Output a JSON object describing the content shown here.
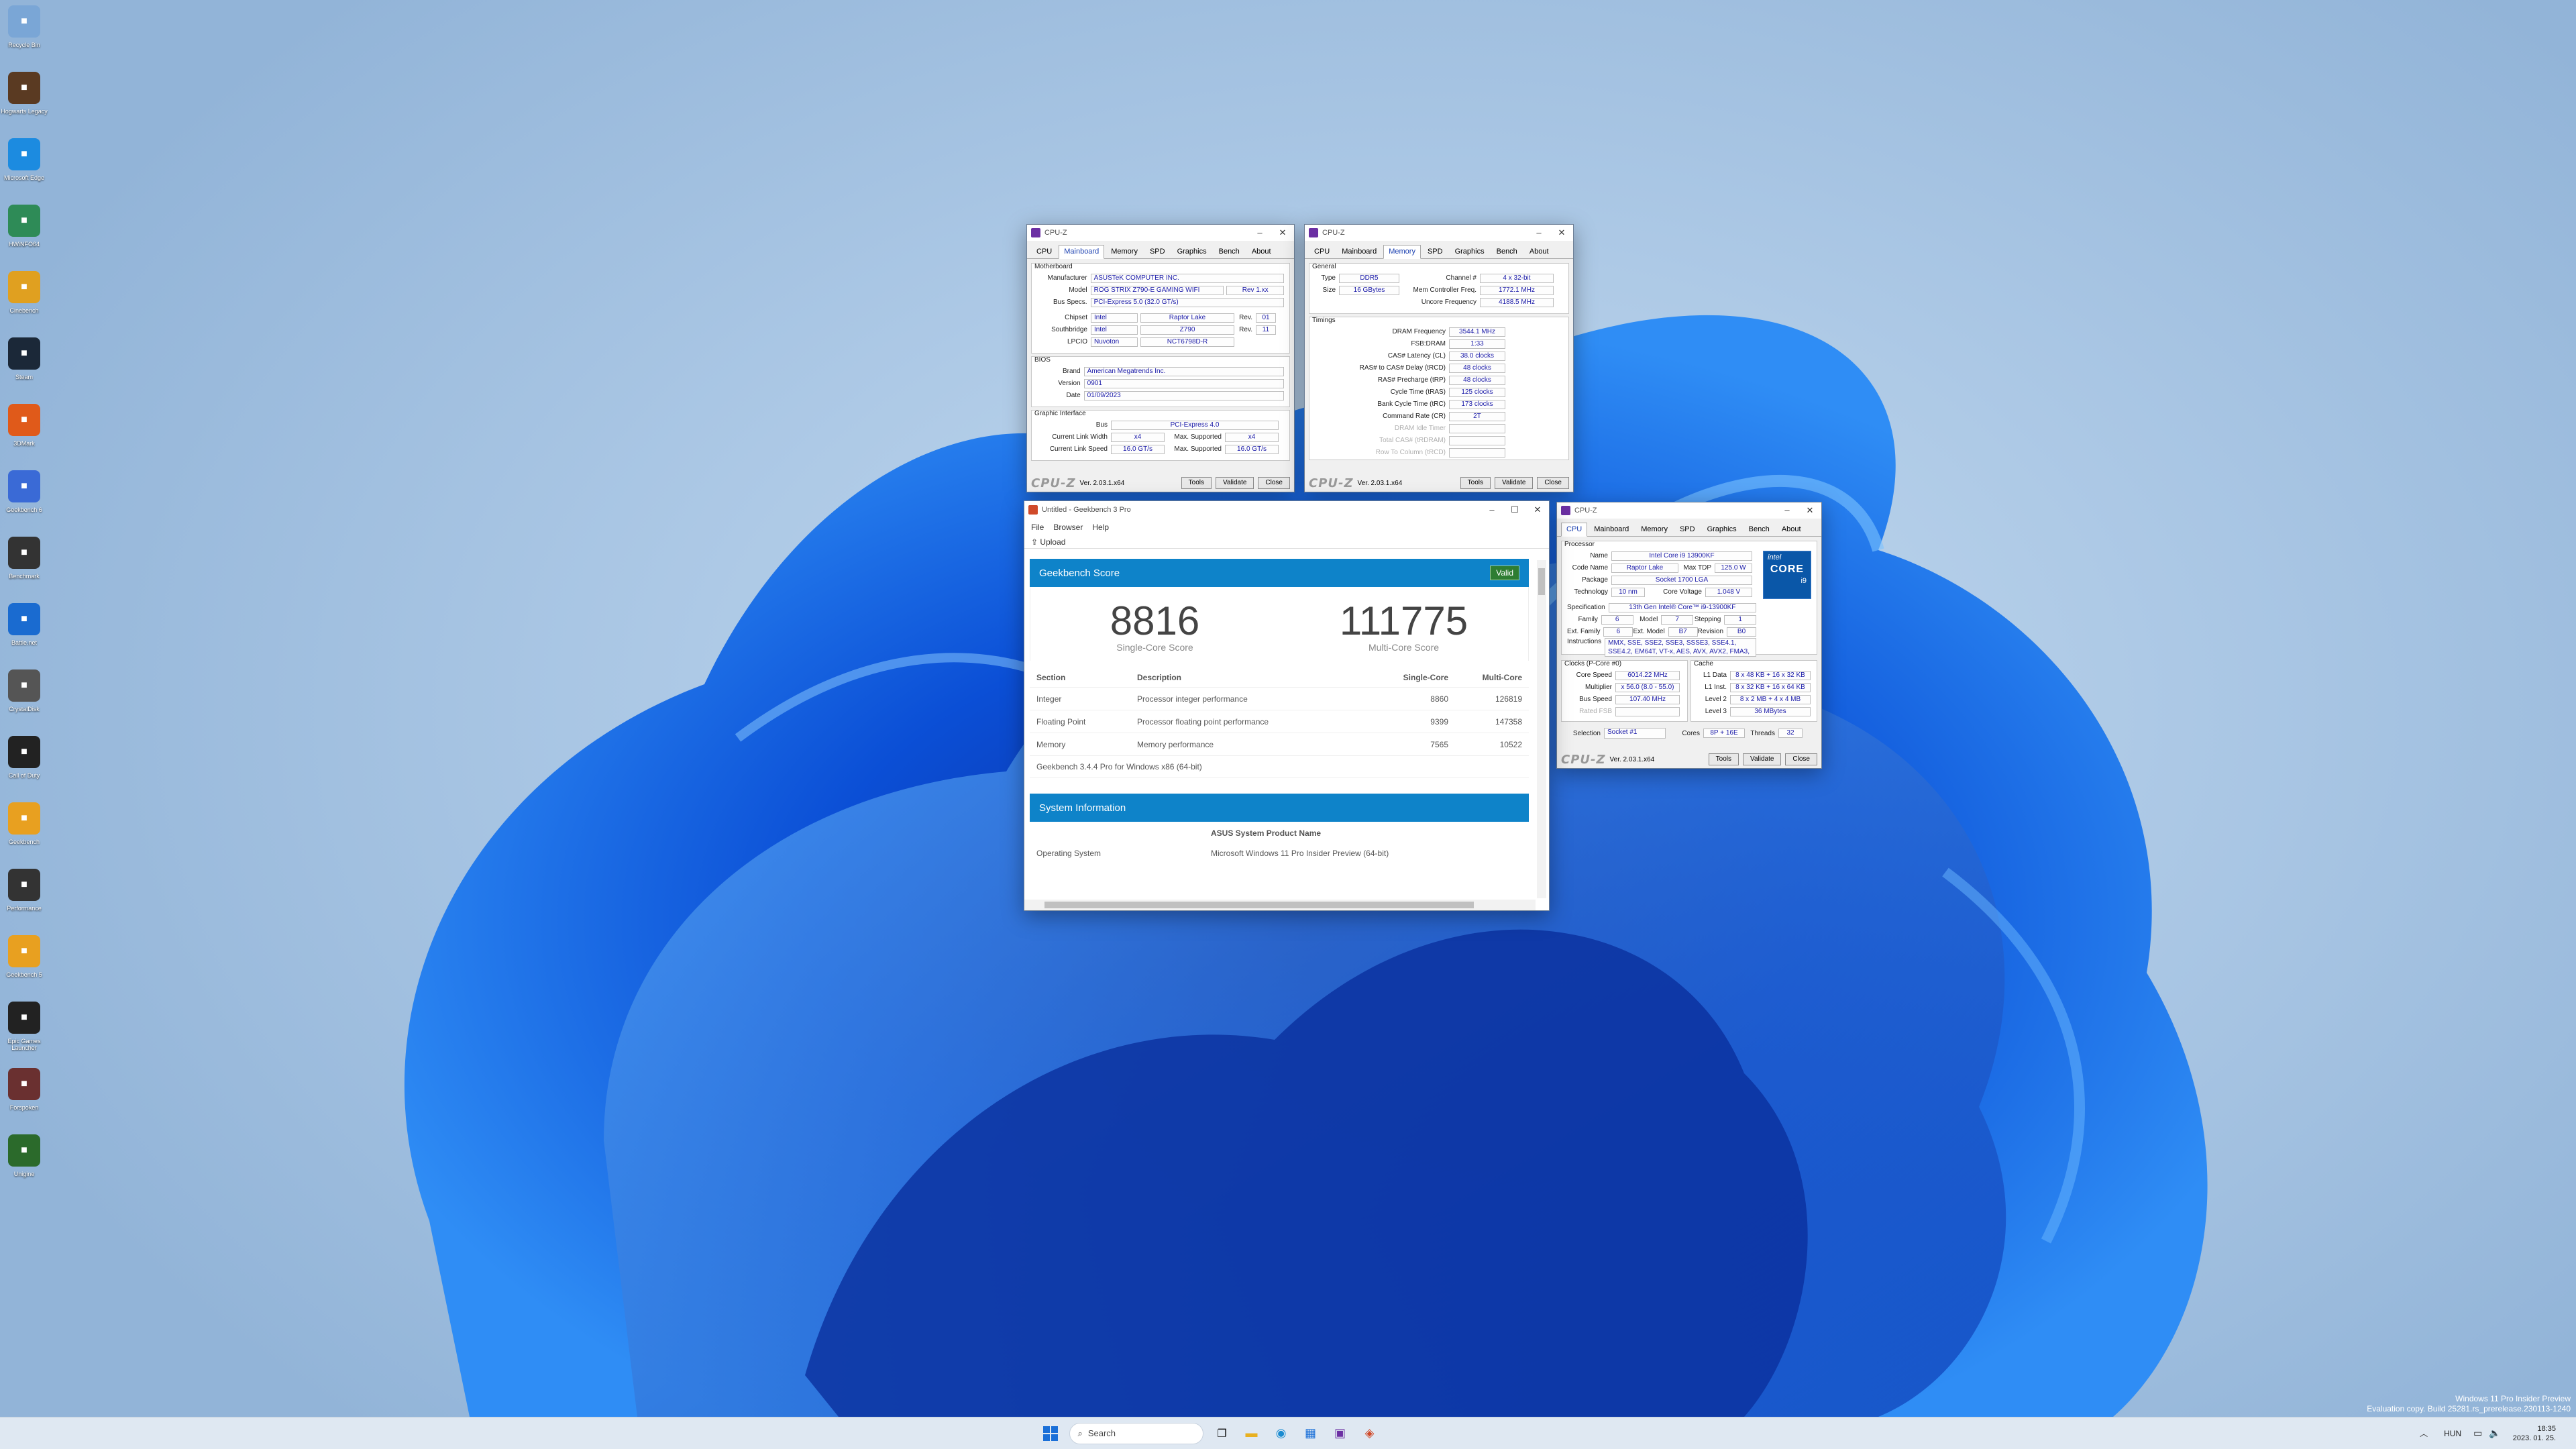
{
  "desktop_icons": [
    {
      "label": "Recycle Bin",
      "color": "#7aa6d6"
    },
    {
      "label": "Hogwarts Legacy",
      "color": "#5a3a22"
    },
    {
      "label": "Microsoft Edge",
      "color": "#1c8be0"
    },
    {
      "label": "HWiNFO64",
      "color": "#2e8b57"
    },
    {
      "label": "Cinebench",
      "color": "#e0a020"
    },
    {
      "label": "Steam",
      "color": "#1b2838"
    },
    {
      "label": "3DMark",
      "color": "#e05a1a"
    },
    {
      "label": "Geekbench 6",
      "color": "#3a6ad6"
    },
    {
      "label": "Benchmark",
      "color": "#333"
    },
    {
      "label": "Battle.net",
      "color": "#1a6bd0"
    },
    {
      "label": "CrystalDisk",
      "color": "#555"
    },
    {
      "label": "Call of Duty",
      "color": "#222"
    },
    {
      "label": "Geekbench",
      "color": "#e8a020"
    },
    {
      "label": "Performance",
      "color": "#333"
    },
    {
      "label": "Geekbench 5",
      "color": "#e8a020"
    },
    {
      "label": "Epic Games Launcher",
      "color": "#222"
    },
    {
      "label": "Forspoken",
      "color": "#6a3030"
    },
    {
      "label": "Unigine",
      "color": "#2b6a2b"
    }
  ],
  "cpuz_mb": {
    "title": "CPU-Z",
    "tabs": [
      "CPU",
      "Mainboard",
      "Memory",
      "SPD",
      "Graphics",
      "Bench",
      "About"
    ],
    "active": "Mainboard",
    "motherboard_label": "Motherboard",
    "manufacturer_label": "Manufacturer",
    "manufacturer": "ASUSTeK COMPUTER INC.",
    "model_label": "Model",
    "model": "ROG STRIX Z790-E GAMING WIFI",
    "model_rev": "Rev 1.xx",
    "busspecs_label": "Bus Specs.",
    "busspecs": "PCI-Express 5.0 (32.0 GT/s)",
    "chipset_label": "Chipset",
    "chipset_vendor": "Intel",
    "chipset": "Raptor Lake",
    "rev_label": "Rev.",
    "chipset_rev": "01",
    "southbridge_label": "Southbridge",
    "sb_vendor": "Intel",
    "sb": "Z790",
    "sb_rev": "11",
    "lpcio_label": "LPCIO",
    "lpc_vendor": "Nuvoton",
    "lpc": "NCT6798D-R",
    "bios_label": "BIOS",
    "brand_label": "Brand",
    "brand": "American Megatrends Inc.",
    "version_label": "Version",
    "version": "0901",
    "date_label": "Date",
    "date": "01/09/2023",
    "gi_label": "Graphic Interface",
    "bus_label": "Bus",
    "bus": "PCI-Express 4.0",
    "clw_label": "Current Link Width",
    "clw": "x4",
    "msw_label": "Max. Supported",
    "msw": "x4",
    "cls_label": "Current Link Speed",
    "cls": "16.0 GT/s",
    "mss_label": "Max. Supported",
    "mss": "16.0 GT/s",
    "ver": "Ver. 2.03.1.x64",
    "tools": "Tools",
    "validate": "Validate",
    "close": "Close"
  },
  "cpuz_mem": {
    "title": "CPU-Z",
    "tabs": [
      "CPU",
      "Mainboard",
      "Memory",
      "SPD",
      "Graphics",
      "Bench",
      "About"
    ],
    "active": "Memory",
    "general_label": "General",
    "type_label": "Type",
    "type": "DDR5",
    "channel_label": "Channel #",
    "channel": "4 x 32-bit",
    "size_label": "Size",
    "size": "16 GBytes",
    "mcf_label": "Mem Controller Freq.",
    "mcf": "1772.1 MHz",
    "uncore_label": "Uncore Frequency",
    "uncore": "4188.5 MHz",
    "timings_label": "Timings",
    "timings": [
      {
        "label": "DRAM Frequency",
        "value": "3544.1 MHz",
        "dim": false
      },
      {
        "label": "FSB:DRAM",
        "value": "1:33",
        "dim": false
      },
      {
        "label": "CAS# Latency (CL)",
        "value": "38.0 clocks",
        "dim": false
      },
      {
        "label": "RAS# to CAS# Delay (tRCD)",
        "value": "48 clocks",
        "dim": false
      },
      {
        "label": "RAS# Precharge (tRP)",
        "value": "48 clocks",
        "dim": false
      },
      {
        "label": "Cycle Time (tRAS)",
        "value": "125 clocks",
        "dim": false
      },
      {
        "label": "Bank Cycle Time (tRC)",
        "value": "173 clocks",
        "dim": false
      },
      {
        "label": "Command Rate (CR)",
        "value": "2T",
        "dim": false
      },
      {
        "label": "DRAM Idle Timer",
        "value": "",
        "dim": true
      },
      {
        "label": "Total CAS# (tRDRAM)",
        "value": "",
        "dim": true
      },
      {
        "label": "Row To Column (tRCD)",
        "value": "",
        "dim": true
      }
    ],
    "ver": "Ver. 2.03.1.x64",
    "tools": "Tools",
    "validate": "Validate",
    "close": "Close"
  },
  "cpuz_cpu": {
    "title": "CPU-Z",
    "tabs": [
      "CPU",
      "Mainboard",
      "Memory",
      "SPD",
      "Graphics",
      "Bench",
      "About"
    ],
    "active": "CPU",
    "processor_label": "Processor",
    "name_label": "Name",
    "name": "Intel Core i9 13900KF",
    "codename_label": "Code Name",
    "codename": "Raptor Lake",
    "tdp_label": "Max TDP",
    "tdp": "125.0 W",
    "package_label": "Package",
    "package": "Socket 1700 LGA",
    "tech_label": "Technology",
    "tech": "10 nm",
    "cv_label": "Core Voltage",
    "cv": "1.048 V",
    "spec_label": "Specification",
    "spec": "13th Gen Intel® Core™ i9-13900KF",
    "family_label": "Family",
    "family": "6",
    "model_label": "Model",
    "model": "7",
    "stepping_label": "Stepping",
    "stepping": "1",
    "extfam_label": "Ext. Family",
    "extfam": "6",
    "extmodel_label": "Ext. Model",
    "extmodel": "B7",
    "revision_label": "Revision",
    "revision": "B0",
    "instr_label": "Instructions",
    "instr": "MMX, SSE, SSE2, SSE3, SSSE3, SSE4.1, SSE4.2, EM64T, VT-x, AES, AVX, AVX2, FMA3, SHA",
    "clocks_label": "Clocks (P-Core #0)",
    "corespeed_label": "Core Speed",
    "corespeed": "6014.22 MHz",
    "mult_label": "Multiplier",
    "mult": "x 56.0 (8.0 - 55.0)",
    "busspeed_label": "Bus Speed",
    "busspeed": "107.40 MHz",
    "ratedfsb_label": "Rated FSB",
    "ratedfsb": "",
    "cache_label": "Cache",
    "l1d_label": "L1 Data",
    "l1d": "8 x 48 KB + 16 x 32 KB",
    "l1i_label": "L1 Inst.",
    "l1i": "8 x 32 KB + 16 x 64 KB",
    "l2_label": "Level 2",
    "l2": "8 x 2 MB + 4 x 4 MB",
    "l3_label": "Level 3",
    "l3": "36 MBytes",
    "selection_label": "Selection",
    "selection": "Socket #1",
    "cores_label": "Cores",
    "cores": "8P + 16E",
    "threads_label": "Threads",
    "threads": "32",
    "badge_top": "intel",
    "badge_mid": "CORE",
    "badge_bot": "i9",
    "ver": "Ver. 2.03.1.x64",
    "tools": "Tools",
    "validate": "Validate",
    "close": "Close"
  },
  "geekbench": {
    "title": "Untitled - Geekbench 3 Pro",
    "menu": [
      "File",
      "Browser",
      "Help"
    ],
    "toolbar": "Upload",
    "score_header": "Geekbench Score",
    "valid": "Valid",
    "single": "8816",
    "single_label": "Single-Core Score",
    "multi": "111775",
    "multi_label": "Multi-Core Score",
    "columns": [
      "Section",
      "Description",
      "Single-Core",
      "Multi-Core"
    ],
    "rows": [
      {
        "section": "Integer",
        "desc": "Processor integer performance",
        "single": "8860",
        "multi": "126819"
      },
      {
        "section": "Floating Point",
        "desc": "Processor floating point performance",
        "single": "9399",
        "multi": "147358"
      },
      {
        "section": "Memory",
        "desc": "Memory performance",
        "single": "7565",
        "multi": "10522"
      }
    ],
    "version_note": "Geekbench 3.4.4 Pro for Windows x86 (64-bit)",
    "sysinfo_header": "System Information",
    "product_name": "ASUS System Product Name",
    "os_label": "Operating System",
    "os": "Microsoft Windows 11 Pro Insider Preview (64-bit)"
  },
  "watermark": {
    "line1": "Windows 11 Pro Insider Preview",
    "line2": "Evaluation copy. Build 25281.rs_prerelease.230113-1240"
  },
  "taskbar": {
    "search_placeholder": "Search",
    "lang": "HUN",
    "time": "18:35",
    "date": "2023. 01. 25."
  }
}
